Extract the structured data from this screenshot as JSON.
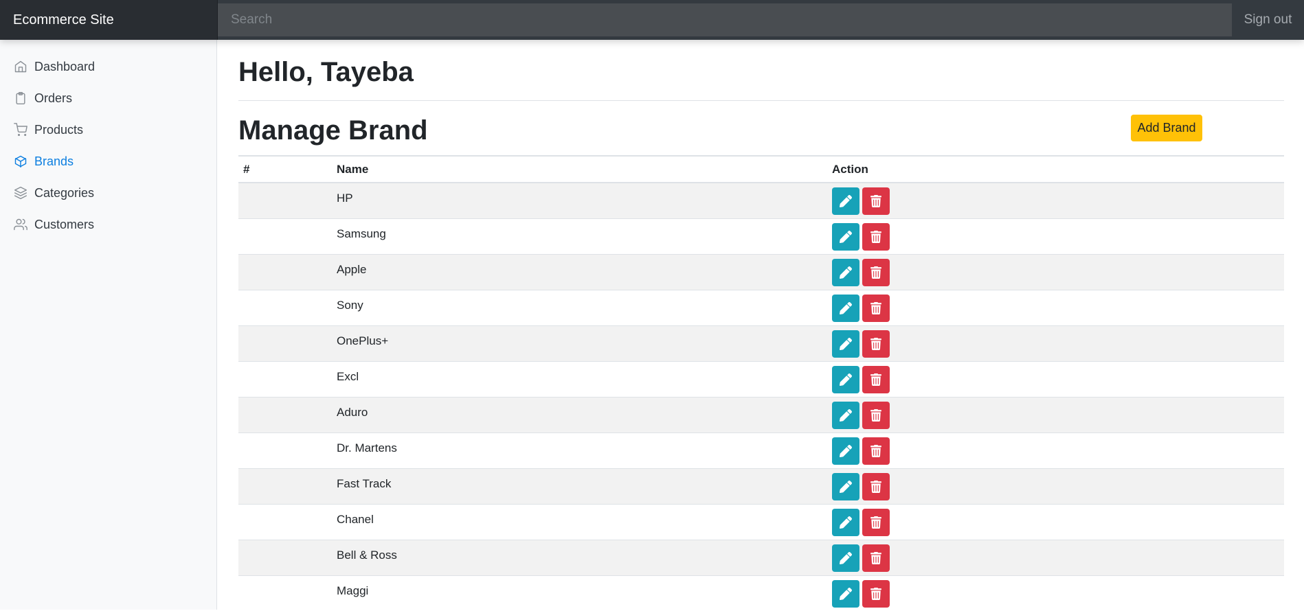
{
  "navbar": {
    "brand": "Ecommerce Site",
    "search_placeholder": "Search",
    "signout_label": "Sign out"
  },
  "sidebar": {
    "items": [
      {
        "label": "Dashboard",
        "icon": "home-icon",
        "active": false
      },
      {
        "label": "Orders",
        "icon": "clipboard-icon",
        "active": false
      },
      {
        "label": "Products",
        "icon": "shopping-cart-icon",
        "active": false
      },
      {
        "label": "Brands",
        "icon": "box-icon",
        "active": true
      },
      {
        "label": "Categories",
        "icon": "layers-icon",
        "active": false
      },
      {
        "label": "Customers",
        "icon": "users-icon",
        "active": false
      }
    ]
  },
  "main": {
    "greeting": "Hello, Tayeba",
    "title": "Manage Brand",
    "add_button_label": "Add Brand",
    "table": {
      "headers": {
        "index": "#",
        "name": "Name",
        "action": "Action"
      },
      "rows": [
        {
          "index": "",
          "name": "HP"
        },
        {
          "index": "",
          "name": "Samsung"
        },
        {
          "index": "",
          "name": "Apple"
        },
        {
          "index": "",
          "name": "Sony"
        },
        {
          "index": "",
          "name": "OnePlus+"
        },
        {
          "index": "",
          "name": "Excl"
        },
        {
          "index": "",
          "name": "Aduro"
        },
        {
          "index": "",
          "name": "Dr. Martens"
        },
        {
          "index": "",
          "name": "Fast Track"
        },
        {
          "index": "",
          "name": "Chanel"
        },
        {
          "index": "",
          "name": "Bell & Ross"
        },
        {
          "index": "",
          "name": "Maggi"
        }
      ],
      "row_actions": [
        {
          "icon": "pencil-icon",
          "color": "#17a2b8"
        },
        {
          "icon": "trash-icon",
          "color": "#dc3545"
        }
      ]
    }
  },
  "colors": {
    "navbar_bg": "#343a40",
    "accent_active": "#0d7fe0",
    "warning": "#ffc107",
    "info": "#17a2b8",
    "danger": "#dc3545"
  }
}
